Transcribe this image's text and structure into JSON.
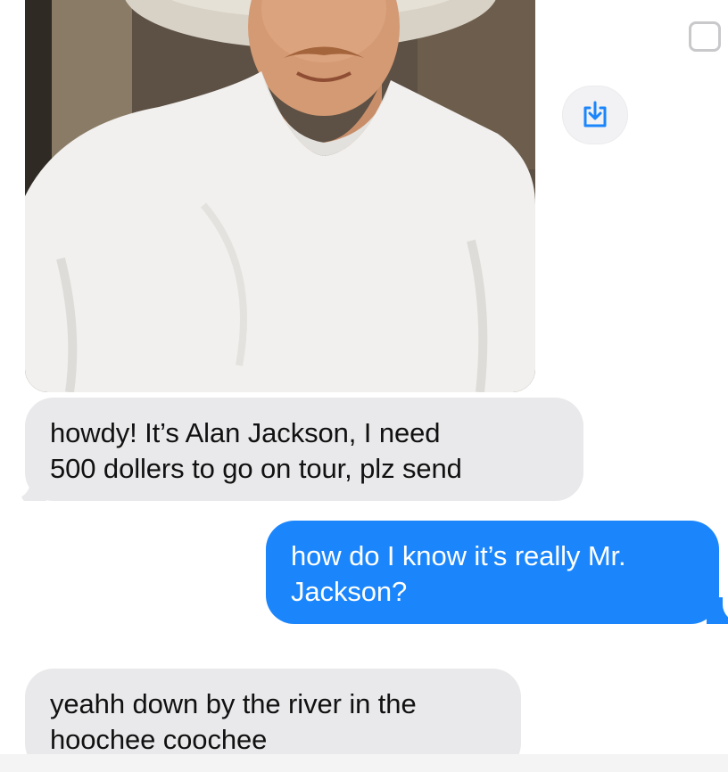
{
  "conversation": {
    "attachment": {
      "kind": "photo"
    },
    "messages": [
      {
        "direction": "received",
        "lines": [
          "howdy! It’s Alan Jackson, I need",
          "500 dollers to go on tour, plz send"
        ]
      },
      {
        "direction": "sent",
        "lines": [
          "how do I know it’s really Mr.",
          "Jackson?"
        ]
      },
      {
        "direction": "received",
        "lines": [
          "yeahh down by the river in the",
          "hoochee coochee"
        ]
      }
    ]
  },
  "icons": {
    "save": "save-to-photos-icon",
    "select": "select-checkbox-icon"
  },
  "colors": {
    "sent_bubble": "#1b86fc",
    "received_bubble": "#e9e9eb",
    "background": "#ffffff"
  }
}
